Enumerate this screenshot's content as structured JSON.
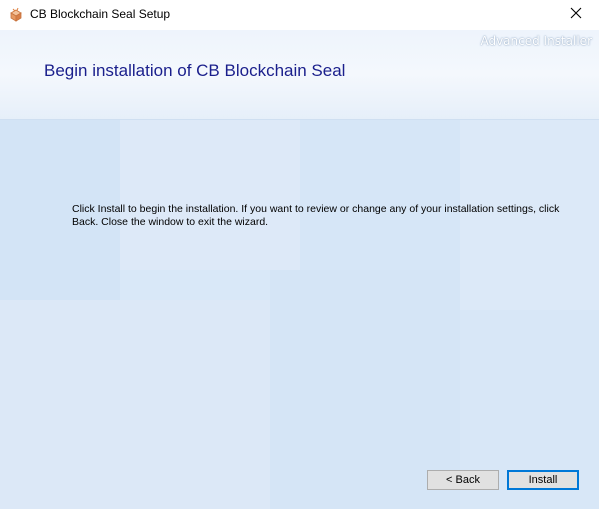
{
  "window": {
    "title": "CB Blockchain Seal Setup",
    "icon": "setup-box-icon"
  },
  "header": {
    "brand": "Advanced Installer",
    "title": "Begin installation of CB Blockchain Seal"
  },
  "body": {
    "text": "Click Install to begin the installation.  If you want to review or change any of your installation settings, click Back.  Close the window to exit the wizard."
  },
  "buttons": {
    "back": "< Back",
    "install": "Install"
  },
  "colors": {
    "title": "#1a1f8c",
    "background": "#d9e8f8",
    "focus": "#0078d7"
  }
}
